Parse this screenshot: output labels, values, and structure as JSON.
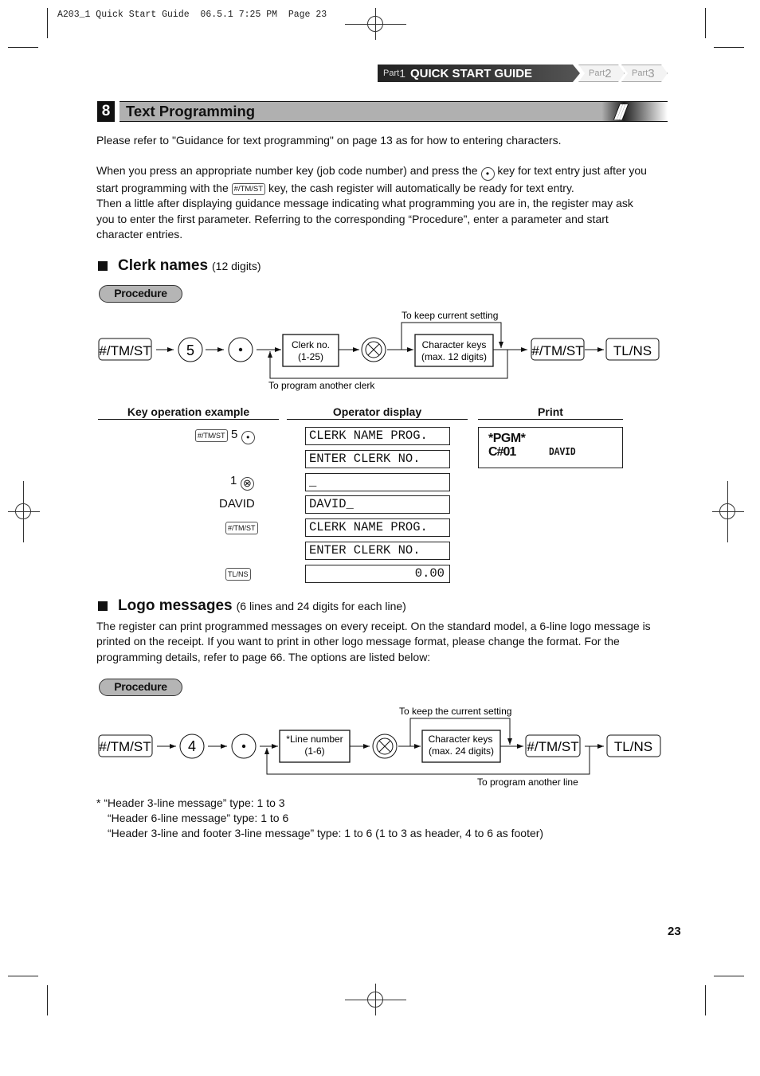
{
  "slug": "A203_1 Quick Start Guide  06.5.1 7:25 PM  Page 23",
  "part_nav": {
    "part1_prefix": "Part",
    "part1_num": "1",
    "part1_title": "QUICK START GUIDE",
    "part2_prefix": "Part",
    "part2_num": "2",
    "part3_prefix": "Part",
    "part3_num": "3"
  },
  "section": {
    "number": "8",
    "title": "Text Programming"
  },
  "intro": {
    "p1": "Please refer to \"Guidance for text programming\" on page 13 as for how to entering characters.",
    "p2_a": "When you press an appropriate number key (job code number) and press the",
    "p2_b": "key for text entry just after you",
    "p2_c": "start programming with the",
    "p2_d": "key, the cash register will automatically be ready for text entry.",
    "p2_e": "Then a little after displaying guidance message indicating what programming you are in, the register may ask",
    "p2_f": "you to enter the first parameter.  Referring to the corresponding “Procedure”, enter a parameter and start",
    "p2_g": "character entries.",
    "dot_key": "•",
    "tmst_key": "#/TM/ST"
  },
  "clerk": {
    "heading": "Clerk names",
    "heading_note": "(12 digits)",
    "procedure_label": "Procedure",
    "flow": {
      "key_tmst": "#/TM/ST",
      "key_5": "5",
      "key_dot": "•",
      "box1_line1": "Clerk no.",
      "box1_line2": "(1-25)",
      "key_x": "⊗",
      "box2_line1": "Character keys",
      "box2_line2": "(max. 12 digits)",
      "keep_label": "To keep current setting",
      "loop_label": "To program another clerk",
      "key_tmst2": "#/TM/ST",
      "key_tlns": "TL/NS"
    },
    "table": {
      "col_keyop": "Key operation example",
      "col_display": "Operator display",
      "col_print": "Print",
      "rows": [
        {
          "key_sm": "#/TM/ST",
          "key_text": "5",
          "key_icon": "•",
          "display": "CLERK NAME PROG."
        },
        {
          "key_sm": "",
          "key_text": "",
          "key_icon": "",
          "display": "ENTER CLERK NO."
        },
        {
          "key_sm": "",
          "key_text": "1",
          "key_icon": "⊗",
          "display": "_"
        },
        {
          "key_sm": "",
          "key_text": "DAVID",
          "key_icon": "",
          "display": "DAVID_"
        },
        {
          "key_sm": "#/TM/ST",
          "key_text": "",
          "key_icon": "",
          "display": "CLERK NAME PROG."
        },
        {
          "key_sm": "",
          "key_text": "",
          "key_icon": "",
          "display": "ENTER CLERK NO."
        },
        {
          "key_sm": "TL/NS",
          "key_text": "",
          "key_icon": "",
          "display": "0.00"
        }
      ],
      "print_line1": "*PGM*",
      "print_line2a": "C#01",
      "print_line2b": "DAVID"
    }
  },
  "logo": {
    "heading": "Logo messages",
    "heading_note": "(6 lines and 24 digits for each line)",
    "p1": "The register can print programmed messages on every receipt. On the standard model, a 6-line logo message is",
    "p2": "printed on the receipt.  If you want to print in other logo message format, please change the format. For the",
    "p3": "programming details, refer to page 66.  The options are listed below:",
    "procedure_label": "Procedure",
    "flow": {
      "key_tmst": "#/TM/ST",
      "key_4": "4",
      "key_dot": "•",
      "box1_line1": "*Line number",
      "box1_line2": "(1-6)",
      "key_x": "⊗",
      "box2_line1": "Character keys",
      "box2_line2": "(max. 24 digits)",
      "keep_label": "To keep the current setting",
      "loop_label": "To program another line",
      "key_tmst2": "#/TM/ST",
      "key_tlns": "TL/NS"
    },
    "notes": [
      "*  “Header 3-line message” type: 1 to 3",
      "“Header 6-line message” type: 1 to 6",
      "“Header 3-line and footer 3-line message” type: 1 to 6 (1 to 3 as header, 4 to 6 as footer)"
    ]
  },
  "page_number": "23"
}
